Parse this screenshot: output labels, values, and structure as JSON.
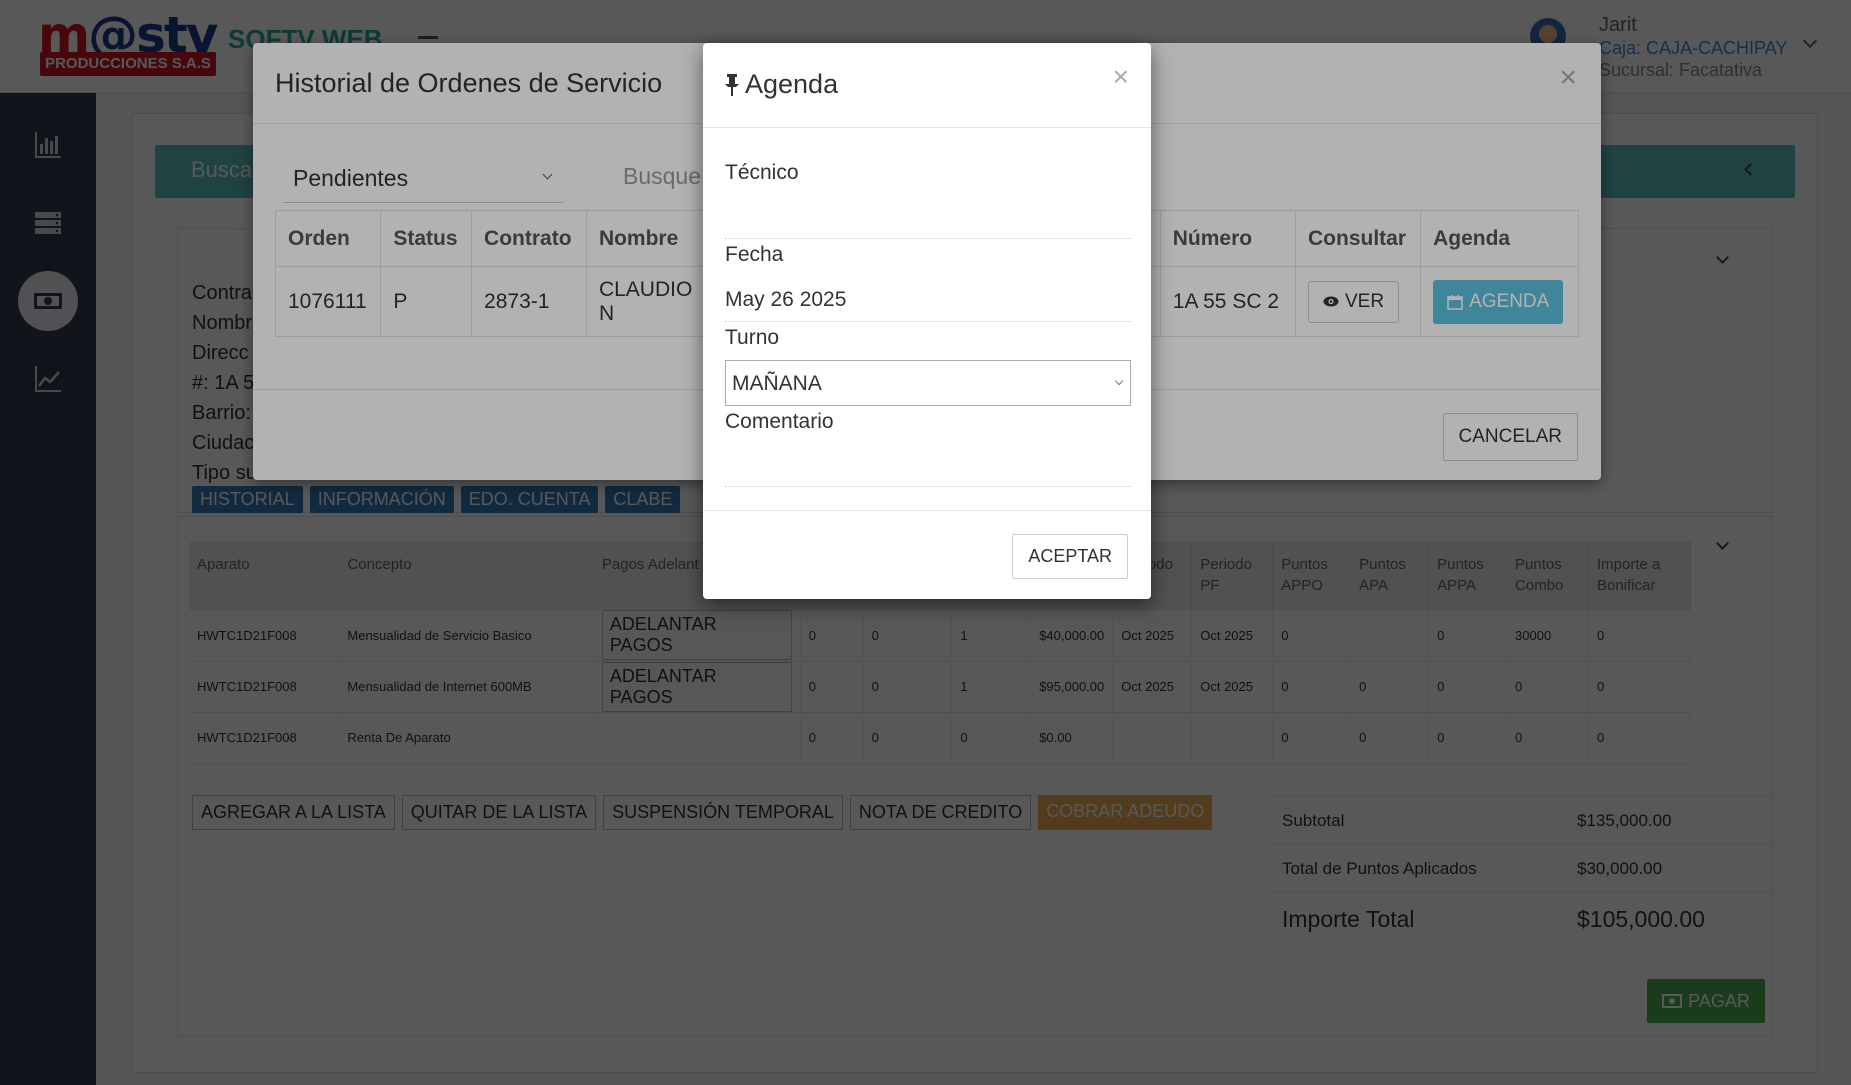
{
  "header": {
    "logo_text_a": "m",
    "logo_text_b": "@",
    "logo_text_c": "stv",
    "logo_sub": "PRODUCCIONES S.A.S",
    "app_name": "SOFTV WEB",
    "user_name": "Jarit",
    "caja": "Caja: CAJA-CACHIPAY",
    "sucursal": "Sucursal: Facatativa"
  },
  "sidebar": {
    "items": [
      {
        "icon": "bar-chart-icon"
      },
      {
        "icon": "server-icon"
      },
      {
        "icon": "money-icon"
      },
      {
        "icon": "line-chart-icon"
      }
    ]
  },
  "search_bar": {
    "label": "Busca"
  },
  "client": {
    "lines": [
      "Contra",
      "Nombr",
      "Direcc",
      "#: 1A 5",
      "Barrio:",
      "Ciudac",
      "Tipo su"
    ]
  },
  "tags": [
    "HISTORIAL",
    "INFORMACIÓN",
    "EDO. CUENTA",
    "CLABE"
  ],
  "concepts": {
    "headers": [
      "Aparato",
      "Concepto",
      "Pagos Adelant",
      "",
      "",
      "",
      "",
      "Periodo",
      "Periodo PF",
      "Puntos APPO",
      "Puntos APA",
      "Puntos APPA",
      "Puntos Combo",
      "Importe a Bonificar"
    ],
    "adelantar_label": "ADELANTAR PAGOS",
    "rows": [
      {
        "aparato": "HWTC1D21F008",
        "concepto": "Mensualidad de Servicio Basico",
        "has_btn": true,
        "c1": "0",
        "c2": "0",
        "c3": "1",
        "importe": "$40,000.00",
        "periodo": "Oct 2025",
        "periodo_pf": "Oct 2025",
        "appo": "0",
        "apa": "",
        "appa": "0",
        "combo": "30000",
        "bonificar": "0"
      },
      {
        "aparato": "HWTC1D21F008",
        "concepto": "Mensualidad de Internet 600MB",
        "has_btn": true,
        "c1": "0",
        "c2": "0",
        "c3": "1",
        "importe": "$95,000.00",
        "periodo": "Oct 2025",
        "periodo_pf": "Oct 2025",
        "appo": "0",
        "apa": "0",
        "appa": "0",
        "combo": "0",
        "bonificar": "0"
      },
      {
        "aparato": "HWTC1D21F008",
        "concepto": "Renta De Aparato",
        "has_btn": false,
        "c1": "0",
        "c2": "0",
        "c3": "0",
        "importe": "$0.00",
        "periodo": "",
        "periodo_pf": "",
        "appo": "0",
        "apa": "0",
        "appa": "0",
        "combo": "0",
        "bonificar": "0"
      }
    ]
  },
  "actions": {
    "add": "AGREGAR A LA LISTA",
    "remove": "QUITAR DE LA LISTA",
    "suspend": "SUSPENSIÓN TEMPORAL",
    "credit": "NOTA DE CREDITO",
    "debt": "COBRAR ADEUDO"
  },
  "totals": {
    "subtotal_label": "Subtotal",
    "subtotal": "$135,000.00",
    "points_label": "Total de Puntos Aplicados",
    "points": "$30,000.00",
    "total_label": "Importe Total",
    "total": "$105,000.00"
  },
  "pay_label": "PAGAR",
  "historial_modal": {
    "title": "Historial de Ordenes de Servicio",
    "close": "×",
    "filter": "Pendientes",
    "search_placeholder": "Busque",
    "headers": [
      "Orden",
      "Status",
      "Contrato",
      "Nombre",
      "",
      "Número",
      "Consultar",
      "Agenda"
    ],
    "row": {
      "orden": "1076111",
      "status": "P",
      "contrato": "2873-1",
      "nombre": "CLAUDIO N",
      "numero": "1A 55 SC 2"
    },
    "ver_label": "VER",
    "agenda_label": "AGENDA",
    "cancel_label": "CANCELAR"
  },
  "agenda_modal": {
    "title": "Agenda",
    "close": "×",
    "tecnico_label": "Técnico",
    "tecnico_value": "",
    "fecha_label": "Fecha",
    "fecha_value": "May 26 2025",
    "turno_label": "Turno",
    "turno_value": "MAÑANA",
    "comentario_label": "Comentario",
    "comentario_value": "",
    "accept_label": "ACEPTAR"
  }
}
